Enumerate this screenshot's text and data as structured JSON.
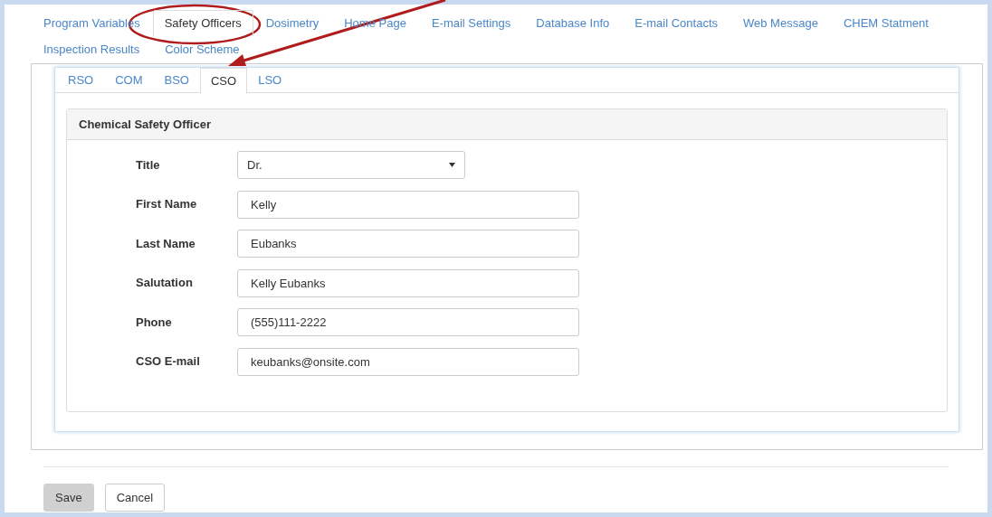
{
  "main_tabs": [
    {
      "label": "Program Variables",
      "selected": false
    },
    {
      "label": "Safety Officers",
      "selected": true
    },
    {
      "label": "Dosimetry",
      "selected": false
    },
    {
      "label": "Home Page",
      "selected": false
    },
    {
      "label": "E-mail Settings",
      "selected": false
    },
    {
      "label": "Database Info",
      "selected": false
    },
    {
      "label": "E-mail Contacts",
      "selected": false
    },
    {
      "label": "Web Message",
      "selected": false
    },
    {
      "label": "CHEM Statment",
      "selected": false
    },
    {
      "label": "Inspection Results",
      "selected": false
    },
    {
      "label": "Color Scheme",
      "selected": false
    }
  ],
  "sub_tabs": [
    {
      "label": "RSO",
      "selected": false
    },
    {
      "label": "COM",
      "selected": false
    },
    {
      "label": "BSO",
      "selected": false
    },
    {
      "label": "CSO",
      "selected": true
    },
    {
      "label": "LSO",
      "selected": false
    }
  ],
  "section": {
    "title": "Chemical Safety Officer",
    "fields": [
      {
        "label": "Title",
        "kind": "select",
        "value": "Dr."
      },
      {
        "label": "First Name",
        "kind": "text",
        "value": "Kelly"
      },
      {
        "label": "Last Name",
        "kind": "text",
        "value": "Eubanks"
      },
      {
        "label": "Salutation",
        "kind": "text",
        "value": "Kelly Eubanks"
      },
      {
        "label": "Phone",
        "kind": "text",
        "value": "(555)111-2222"
      },
      {
        "label": "CSO E-mail",
        "kind": "text",
        "value": "keubanks@onsite.com"
      }
    ]
  },
  "buttons": [
    {
      "label": "Save",
      "kind": "primary"
    },
    {
      "label": "Cancel",
      "kind": "default"
    }
  ]
}
